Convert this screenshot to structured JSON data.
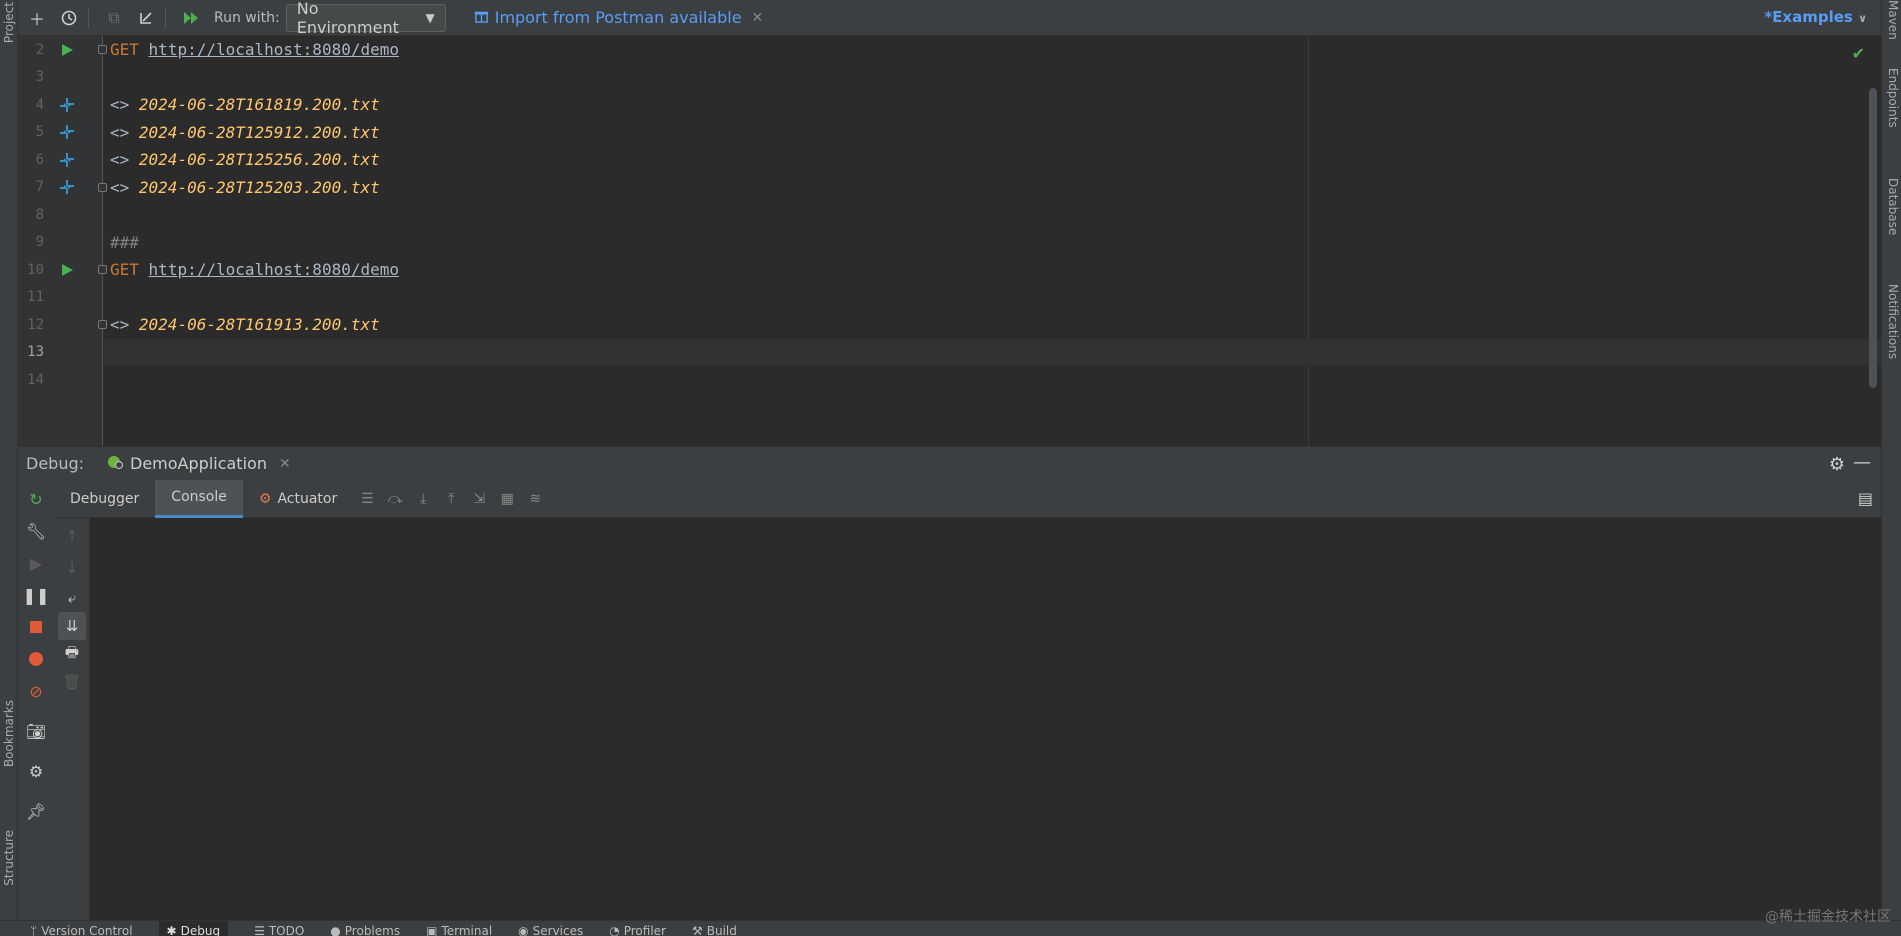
{
  "left_strip": {
    "project": "Project",
    "bookmarks": "Bookmarks",
    "structure": "Structure"
  },
  "right_strip": {
    "maven": "Maven",
    "endpoints": "Endpoints",
    "database": "Database",
    "notifications": "Notifications"
  },
  "toolbar": {
    "run_with_label": "Run with:",
    "environment": "No Environment",
    "import_label": "Import from Postman available",
    "examples_label": "*Examples"
  },
  "editor": {
    "lines": [
      {
        "num": "2",
        "method": "GET",
        "url": "http://localhost:8080/demo"
      },
      {
        "num": "3"
      },
      {
        "num": "4",
        "arrow": "<>",
        "file": "2024-06-28T161819.200.txt"
      },
      {
        "num": "5",
        "arrow": "<>",
        "file": "2024-06-28T125912.200.txt"
      },
      {
        "num": "6",
        "arrow": "<>",
        "file": "2024-06-28T125256.200.txt"
      },
      {
        "num": "7",
        "arrow": "<>",
        "file": "2024-06-28T125203.200.txt"
      },
      {
        "num": "8"
      },
      {
        "num": "9",
        "separator": "###"
      },
      {
        "num": "10",
        "method": "GET",
        "url": "http://localhost:8080/demo"
      },
      {
        "num": "11"
      },
      {
        "num": "12",
        "arrow": "<>",
        "file": "2024-06-28T161913.200.txt"
      },
      {
        "num": "13"
      },
      {
        "num": "14"
      }
    ]
  },
  "debug": {
    "label": "Debug:",
    "app_tab": "DemoApplication",
    "tabs": [
      "Debugger",
      "Console",
      "Actuator"
    ],
    "active_tab": "Console"
  },
  "bottom_bar": {
    "items": [
      "Version Control",
      "Debug",
      "TODO",
      "Problems",
      "Terminal",
      "Services",
      "Profiler",
      "Build"
    ],
    "active": "Debug"
  },
  "watermark": "@稀土掘金技术社区",
  "colors": {
    "accent": "#589df6",
    "run_green": "#4caf50",
    "keyword": "#cc7832",
    "filename": "#ffc66d"
  }
}
